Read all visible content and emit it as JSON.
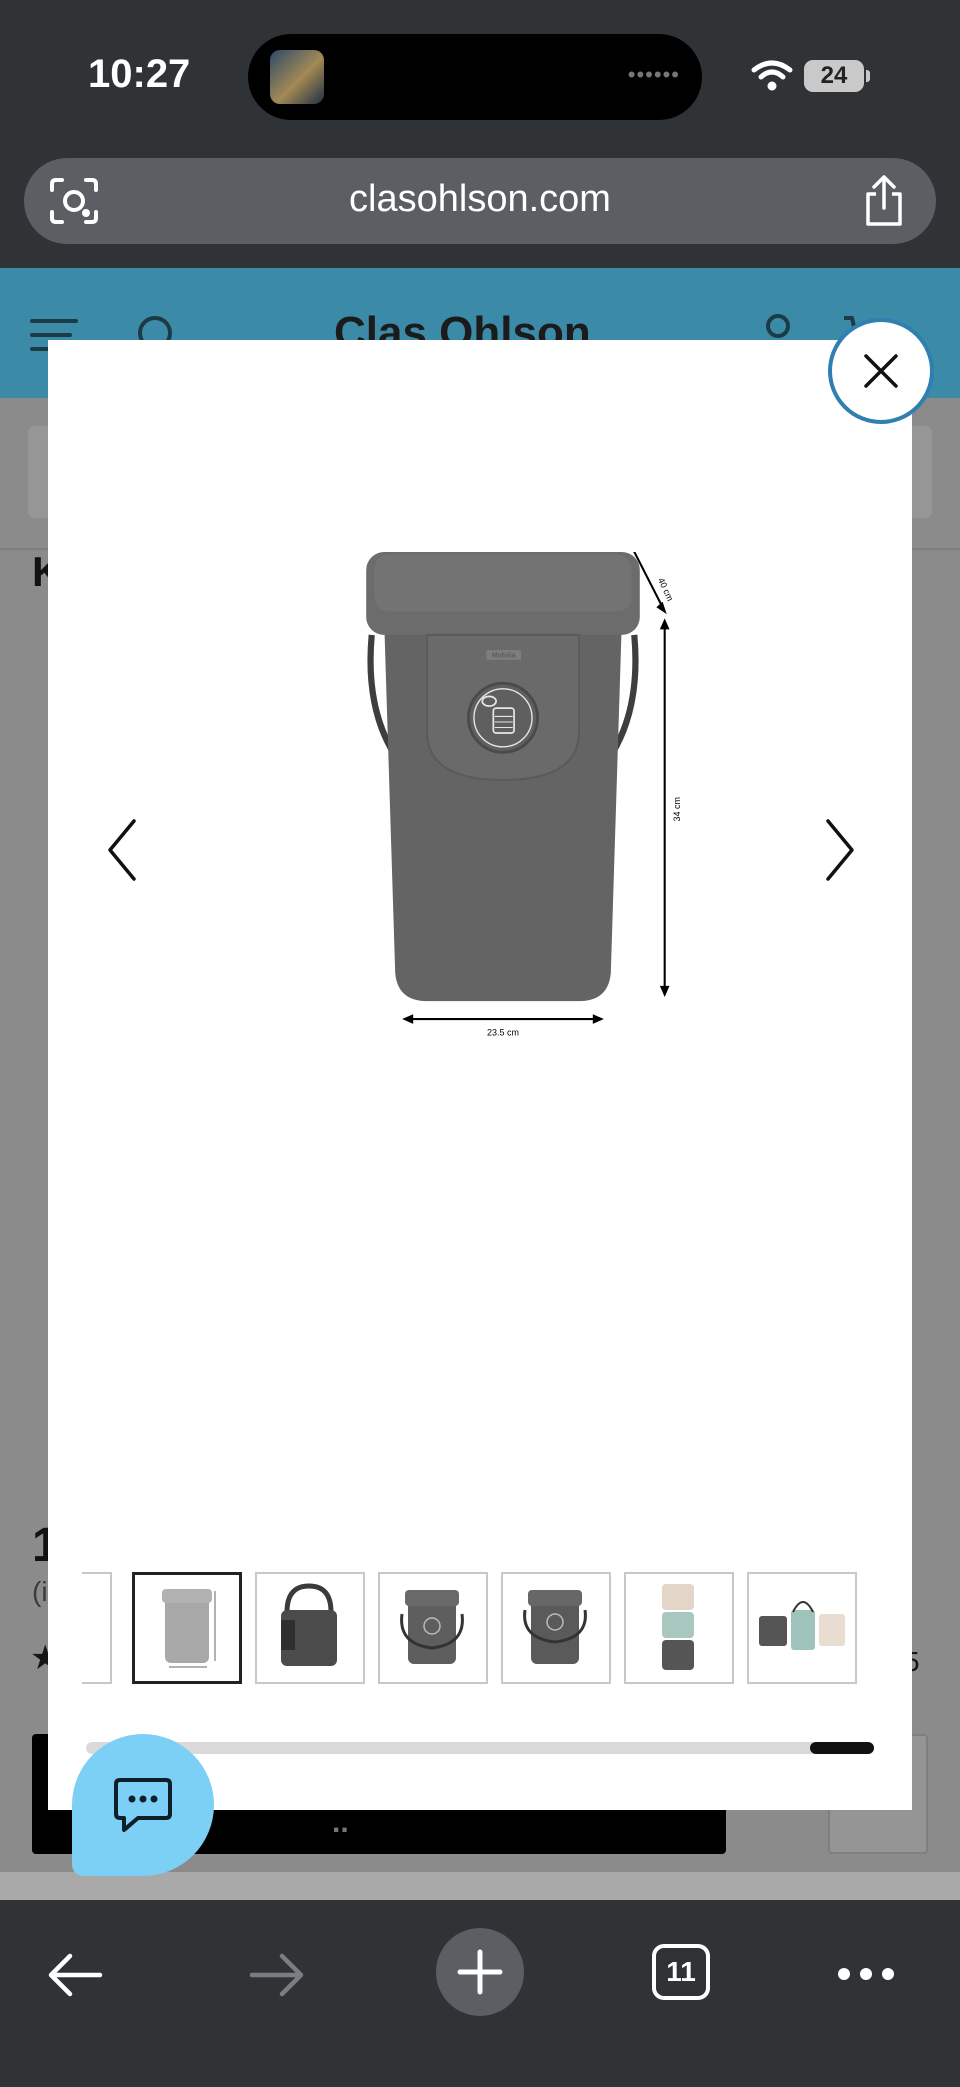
{
  "status_bar": {
    "time": "10:27",
    "island_dots": "••••••",
    "battery": "24",
    "icons": [
      "wifi-icon",
      "battery-icon"
    ]
  },
  "url_bar": {
    "url": "clasohlson.com",
    "icons": [
      "camera-search-icon",
      "share-icon"
    ]
  },
  "site": {
    "logo": "Clas Ohlson",
    "title_fragment": "K",
    "price_fragment": "1",
    "price_note_fragment": "(i",
    "star": "★",
    "review_fragment": "5",
    "buy_fragment": "..",
    "icons": [
      "menu-icon",
      "search-icon",
      "account-icon",
      "cart-icon"
    ]
  },
  "modal": {
    "image": {
      "depth_label": "40 cm",
      "height_label": "34 cm",
      "width_label": "23.5 cm",
      "brand_label": "Mobilia",
      "recycling_symbol": "can"
    },
    "thumbnails": [
      {
        "subject": "partial",
        "selected": false
      },
      {
        "subject": "dimensions",
        "selected": true
      },
      {
        "subject": "tote",
        "selected": false
      },
      {
        "subject": "bin-front",
        "selected": false
      },
      {
        "subject": "bin-front",
        "selected": false
      },
      {
        "subject": "stacked-bins",
        "selected": false
      },
      {
        "subject": "bin-set",
        "selected": false
      }
    ],
    "gallery_scroll_position": 0.92,
    "colors": {
      "close_ring": "#2f7fb0",
      "bin": "#646464"
    }
  },
  "chat": {
    "icon": "chat-bubble-icon",
    "color": "#7ccff5"
  },
  "toolbar": {
    "tab_count": "11",
    "icons": [
      "back-arrow-icon",
      "forward-arrow-icon",
      "plus-icon",
      "tabs-icon",
      "more-icon"
    ]
  }
}
